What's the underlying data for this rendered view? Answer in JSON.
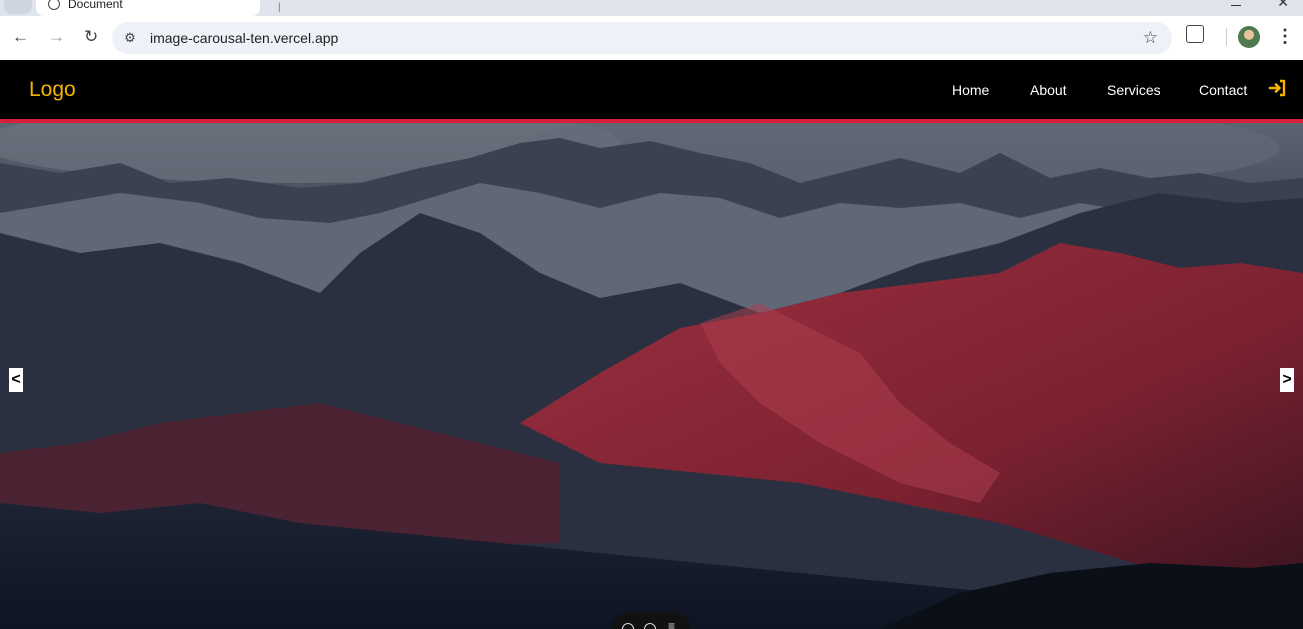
{
  "browser": {
    "tab_title": "Document",
    "url": "image-carousal-ten.vercel.app"
  },
  "site": {
    "logo": "Logo",
    "nav": [
      "Home",
      "About",
      "Services",
      "Contact"
    ],
    "accent_color": "#f5b400",
    "border_color": "#d8203a"
  },
  "carousel": {
    "prev_label": "<",
    "next_label": ">"
  }
}
